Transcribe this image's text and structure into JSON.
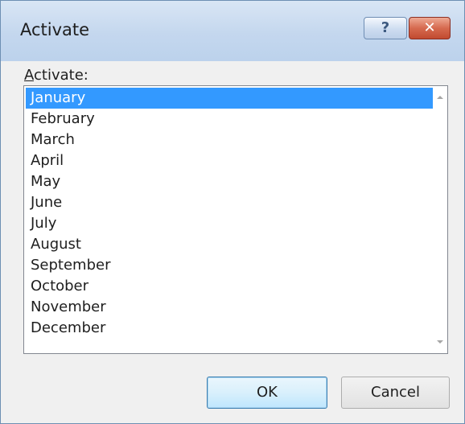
{
  "window": {
    "title": "Activate",
    "help_label": "?",
    "close_label": "✕"
  },
  "list": {
    "label_accel": "A",
    "label_rest": "ctivate:",
    "items": [
      "January",
      "February",
      "March",
      "April",
      "May",
      "June",
      "July",
      "August",
      "September",
      "October",
      "November",
      "December"
    ],
    "selected": "January"
  },
  "buttons": {
    "ok": "OK",
    "cancel": "Cancel"
  },
  "icons": {
    "scroll_up": "scroll-up-arrow",
    "scroll_down": "scroll-down-arrow"
  },
  "colors": {
    "selection": "#3399ff",
    "close_button": "#c9573d",
    "titlebar": "#c4d7ee"
  }
}
